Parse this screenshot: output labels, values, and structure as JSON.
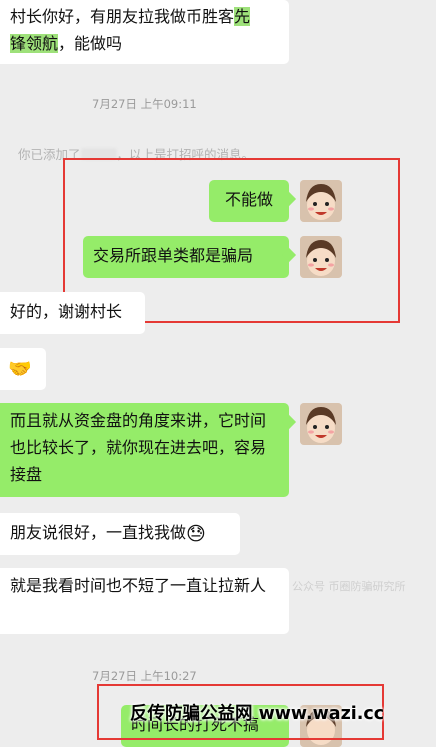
{
  "messages": {
    "m1_line1_pre": "村长你好，有朋友拉我做币胜客",
    "m1_line1_hl": "先",
    "m1_line2_hl": "锋领航",
    "m1_line2_post": "，能做吗",
    "t1": "7月27日 上午09:11",
    "sys_pre": "你已添加了",
    "sys_post": "，以上是打招呼的消息。",
    "m2": "不能做",
    "m3": "交易所跟单类都是骗局",
    "m4": "好的，谢谢村长",
    "m5": "🤝",
    "m6": "而且就从资金盘的角度来讲，它时间也比较长了，就你现在进去吧，容易接盘",
    "m7_text": "朋友说很好，一直找我做",
    "m7_emoji": "😓",
    "m8": "就是我看时间也不短了一直让拉新人",
    "t2": "7月27日 上午10:27",
    "m9": "时间长的打死不搞"
  },
  "watermark": "反传防骗公益网 www.wazi.cc",
  "faint_text": "公众号 币圈防骗研究所"
}
